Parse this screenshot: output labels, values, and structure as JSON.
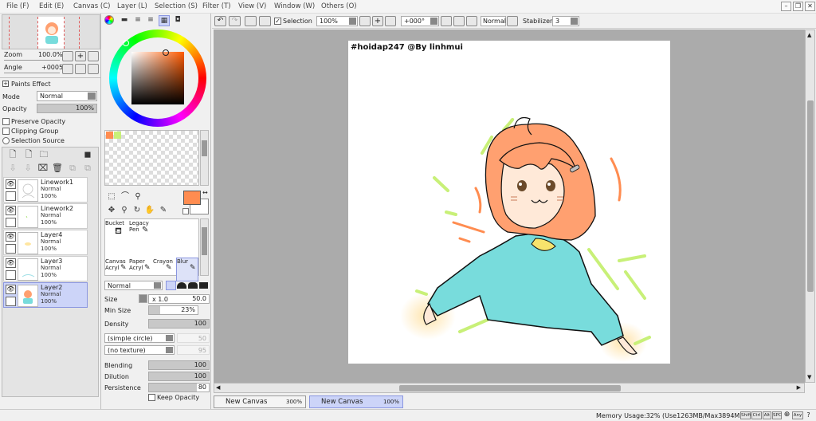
{
  "menu": {
    "items": [
      "File (F)",
      "Edit (E)",
      "Canvas (C)",
      "Layer (L)",
      "Selection (S)",
      "Filter (T)",
      "View (V)",
      "Window (W)",
      "Others (O)"
    ]
  },
  "navigator": {
    "zoom_label": "Zoom",
    "zoom_value": "100.0%",
    "angle_label": "Angle",
    "angle_value": "+0005"
  },
  "layer_props": {
    "paints_effect": "Paints Effect",
    "mode_label": "Mode",
    "mode_value": "Normal",
    "opacity_label": "Opacity",
    "opacity_value": "100%",
    "preserve_opacity": "Preserve Opacity",
    "clipping_group": "Clipping Group",
    "selection_source": "Selection Source"
  },
  "layers": [
    {
      "name": "Linework1",
      "mode": "Normal",
      "opacity": "100%",
      "selected": false
    },
    {
      "name": "Linework2",
      "mode": "Normal",
      "opacity": "100%",
      "selected": false
    },
    {
      "name": "Layer4",
      "mode": "Normal",
      "opacity": "100%",
      "selected": false
    },
    {
      "name": "Layer3",
      "mode": "Normal",
      "opacity": "100%",
      "selected": false
    },
    {
      "name": "Layer2",
      "mode": "Normal",
      "opacity": "100%",
      "selected": true
    }
  ],
  "tools": [
    {
      "line1": "Bucket",
      "line2": ""
    },
    {
      "line1": "Legacy",
      "line2": "Pen"
    },
    {
      "line1": "Canvas",
      "line2": "Acryl"
    },
    {
      "line1": "Paper",
      "line2": "Acryl"
    },
    {
      "line1": "Crayon",
      "line2": ""
    },
    {
      "line1": "Blur",
      "line2": ""
    }
  ],
  "brush": {
    "blend_mode": "Normal",
    "size_label": "Size",
    "size_mult": "x 1.0",
    "size_value": "50.0",
    "min_size_label": "Min Size",
    "min_size_value": "23%",
    "density_label": "Density",
    "density_value": "100",
    "shape": "(simple circle)",
    "shape_value": "50",
    "texture": "(no texture)",
    "texture_value": "95",
    "blending_label": "Blending",
    "blending_value": "100",
    "dilution_label": "Dilution",
    "dilution_value": "100",
    "persistence_label": "Persistence",
    "persistence_value": "80",
    "keep_opacity": "Keep Opacity"
  },
  "toolbar": {
    "selection_label": "Selection",
    "zoom_value": "100%",
    "angle_value": "+000°",
    "mode_value": "Normal",
    "stabilizer_label": "Stabilizer",
    "stabilizer_value": "3"
  },
  "canvas": {
    "watermark": "#hoidap247 @By linhmui"
  },
  "tabs": [
    {
      "name": "New Canvas",
      "zoom": "300%",
      "active": false
    },
    {
      "name": "New Canvas",
      "zoom": "100%",
      "active": true
    }
  ],
  "status": {
    "memory": "Memory Usage:32% (Use1263MB/Max3894MB)",
    "keys": [
      "Shift",
      "Ctrl",
      "Alt",
      "SPC",
      "Any"
    ]
  },
  "colors": {
    "primary": "#ff8c50",
    "accent_selection": "#ccd4f8",
    "canvas_bg": "#ababab"
  }
}
